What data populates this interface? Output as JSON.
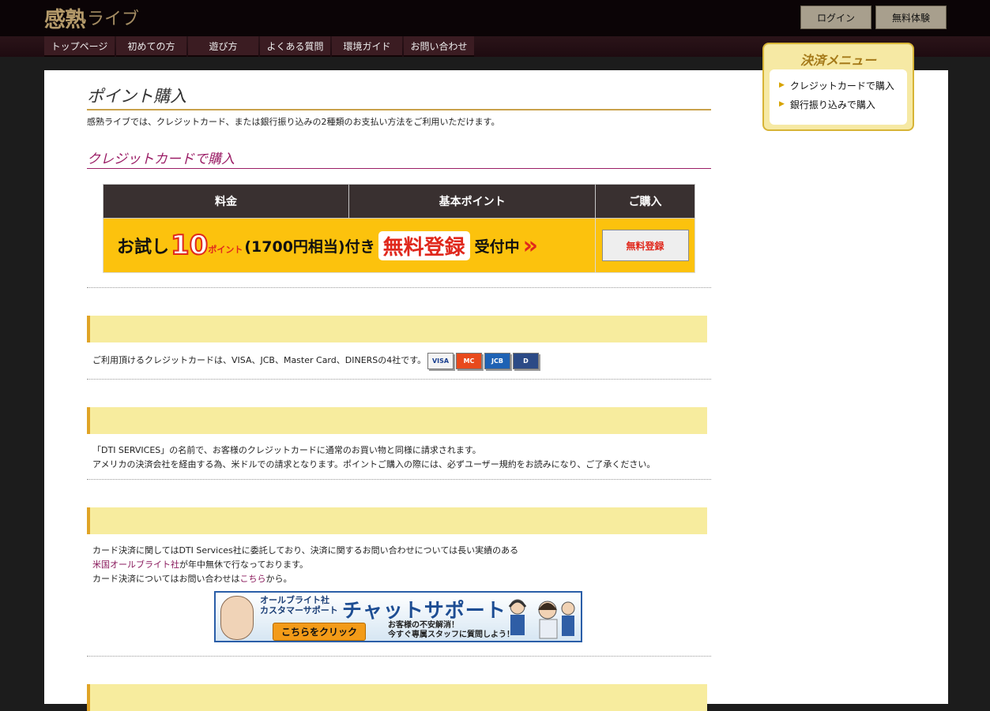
{
  "header": {
    "logo_kanji": "感熟",
    "logo_kana": "ライブ",
    "login_label": "ログイン",
    "trial_label": "無料体験"
  },
  "nav": {
    "items": [
      {
        "label": "トップページ"
      },
      {
        "label": "初めての方"
      },
      {
        "label": "遊び方"
      },
      {
        "label": "よくある質問"
      },
      {
        "label": "環境ガイド"
      },
      {
        "label": "お問い合わせ"
      }
    ]
  },
  "main": {
    "title": "ポイント購入",
    "intro": "感熟ライブでは、クレジットカード、または銀行振り込みの2種類のお支払い方法をご利用いただけます。",
    "credit_heading": "クレジットカードで購入",
    "table": {
      "headers": [
        "料金",
        "基本ポイント",
        "ご購入"
      ],
      "promo": {
        "part1": "お試し",
        "number": "10",
        "point_word": "ポイント",
        "part2": "(1700円相当)付き",
        "register": "無料登録",
        "part3": "受付中",
        "arrow": "»"
      },
      "buy_label": "無料登録"
    },
    "cards_text": "ご利用頂けるクレジットカードは、VISA、JCB、Master Card、DINERSの4社です。",
    "cards": [
      {
        "name": "VISA",
        "color": "#1a3f8f",
        "bg": "#f4f4f4"
      },
      {
        "name": "MC",
        "color": "#ffffff",
        "bg": "#e84a1c"
      },
      {
        "name": "JCB",
        "color": "#ffffff",
        "bg": "#1e62b4"
      },
      {
        "name": "D",
        "color": "#ffffff",
        "bg": "#2b4a86"
      }
    ],
    "dti_line1": "「DTI SERVICES」の名前で、お客様のクレジットカードに通常のお買い物と同様に請求されます。",
    "dti_line2": "アメリカの決済会社を経由する為、米ドルでの請求となります。ポイントご購入の際には、必ずユーザー規約をお読みになり、ご了承ください。",
    "support_line1": "カード決済に関してはDTI Services社に委託しており、決済に関するお問い合わせについては長い実績のある",
    "support_link": "米国オールブライト社",
    "support_line2_rest": "が年中無休で行なっております。",
    "support_line3_pre": "カード決済についてはお問い合わせは",
    "support_here": "こちら",
    "support_line3_post": "から。",
    "chat": {
      "small1": "オールブライト社",
      "small2": "カスタマーサポート",
      "big": "チャットサポート",
      "cta": "こちらをクリック",
      "sub1": "お客様の不安解消！",
      "sub2": "今すぐ専属スタッフに質問しよう！"
    }
  },
  "side": {
    "title": "決済メニュー",
    "items": [
      {
        "label": "クレジットカードで購入"
      },
      {
        "label": "銀行振り込みで購入"
      }
    ]
  }
}
